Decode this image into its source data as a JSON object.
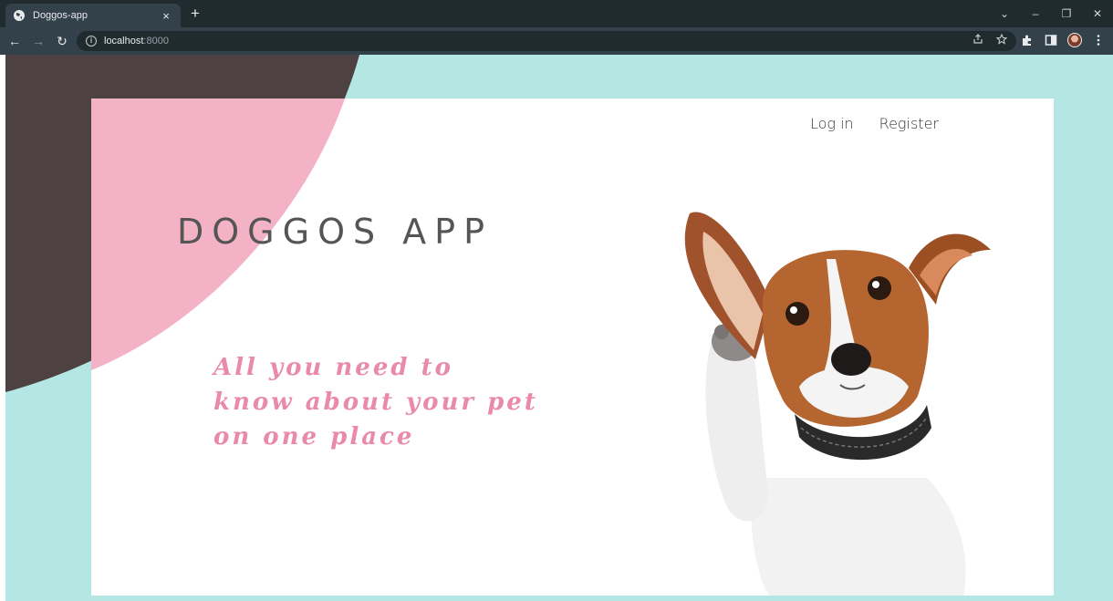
{
  "browser": {
    "tab_title": "Doggos-app",
    "tab_close": "×",
    "new_tab": "+",
    "url_host": "localhost",
    "url_port": ":8000",
    "window_controls": {
      "dropdown": "⌄",
      "minimize": "–",
      "restore": "❐",
      "close": "✕"
    },
    "nav": {
      "back": "←",
      "forward": "→",
      "reload": "↻"
    },
    "icons": [
      "share-icon",
      "star-icon",
      "extensions-icon",
      "sidepanel-icon",
      "avatar",
      "menu-icon"
    ]
  },
  "page": {
    "nav": {
      "login": "Log in",
      "register": "Register"
    },
    "title": "DOGGOS APP",
    "tagline_lines": [
      "All you need to",
      "know about your pet",
      "on one place"
    ]
  },
  "colors": {
    "background": "#b4e6e4",
    "dark_blob": "#4d4142",
    "pink_blob": "#f4b2c6",
    "tagline": "#e98aa8",
    "title": "#555555"
  }
}
